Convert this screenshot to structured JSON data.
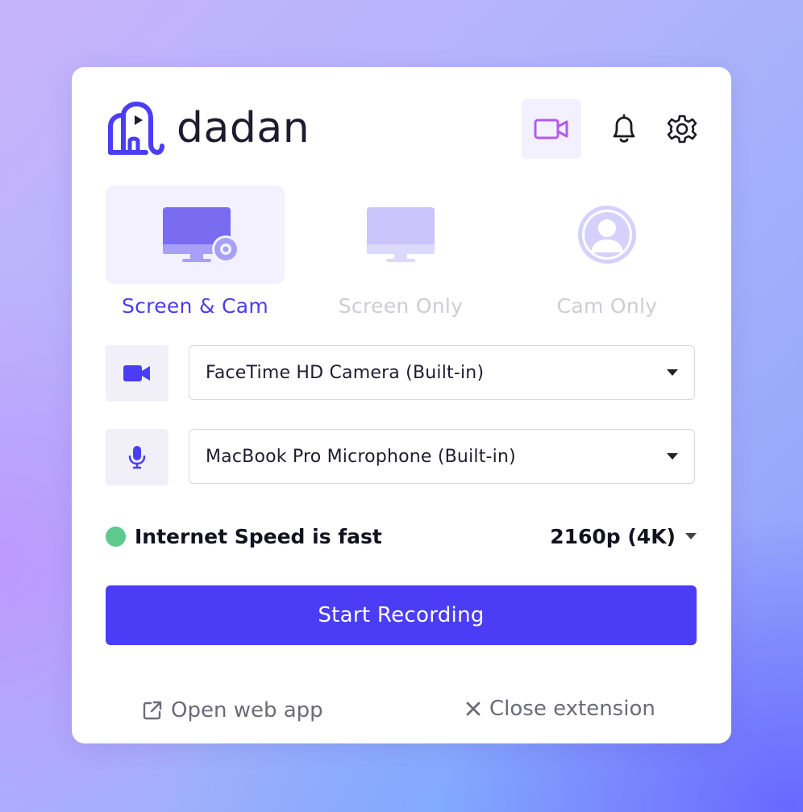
{
  "app": {
    "name": "dadan",
    "logo_icon": "dadan-elephant-logo"
  },
  "header": {
    "camera_icon": "video-camera-icon",
    "notifications_icon": "bell-icon",
    "settings_icon": "gear-icon"
  },
  "modes": {
    "selected": "Screen & Cam",
    "items": [
      {
        "label": "Screen & Cam",
        "icon": "monitor-with-webcam-icon",
        "active": true
      },
      {
        "label": "Screen Only",
        "icon": "monitor-icon",
        "active": false
      },
      {
        "label": "Cam Only",
        "icon": "user-avatar-icon",
        "active": false
      }
    ]
  },
  "devices": {
    "camera": {
      "icon": "video-camera-icon",
      "value": "FaceTime HD Camera (Built-in)"
    },
    "microphone": {
      "icon": "microphone-icon",
      "value": "MacBook Pro Microphone (Built-in)"
    }
  },
  "status": {
    "internet_text": "Internet Speed is fast",
    "indicator_color": "#5cc98f",
    "quality": "2160p (4K)"
  },
  "actions": {
    "start_label": "Start Recording",
    "open_web_app_label": "Open web app",
    "close_extension_label": "Close extension"
  },
  "colors": {
    "accent": "#4b3df5",
    "camera_icon_accent": "#b45be6",
    "inactive_mode": "#cdcdd3"
  }
}
